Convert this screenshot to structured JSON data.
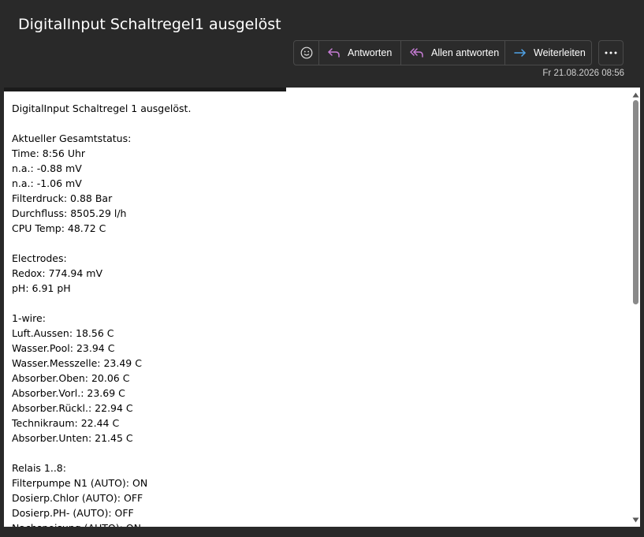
{
  "email": {
    "subject": "DigitalInput Schaltregel1 ausgelöst",
    "date": "Fr 21.08.2026 08:56"
  },
  "toolbar": {
    "emoji_icon": "smiley-icon",
    "reply_label": "Antworten",
    "reply_all_label": "Allen antworten",
    "forward_label": "Weiterleiten",
    "more_icon": "more-dots-icon"
  },
  "colors": {
    "reply_accent": "#c77dd6",
    "forward_accent": "#4fa3e8",
    "background": "#292929"
  },
  "body_lines": [
    "DigitalInput Schaltregel 1 ausgelöst.",
    "",
    "Aktueller Gesamtstatus:",
    "Time: 8:56 Uhr",
    "n.a.: -0.88 mV",
    "n.a.: -1.06 mV",
    "Filterdruck: 0.88 Bar",
    "Durchfluss: 8505.29 l/h",
    "CPU Temp: 48.72 C",
    "",
    "Electrodes:",
    "Redox: 774.94 mV",
    "pH: 6.91 pH",
    "",
    "1-wire:",
    "Luft.Aussen: 18.56 C",
    "Wasser.Pool: 23.94 C",
    "Wasser.Messzelle: 23.49 C",
    "Absorber.Oben: 20.06 C",
    "Absorber.Vorl.: 23.69 C",
    "Absorber.Rückl.: 22.94 C",
    "Technikraum: 22.44 C",
    "Absorber.Unten: 21.45 C",
    "",
    "Relais 1..8:",
    "Filterpumpe N1 (AUTO): ON",
    "Dosierp.Chlor (AUTO): OFF",
    "Dosierp.PH- (AUTO): OFF",
    "Nachspeisung (AUTO): ON"
  ]
}
